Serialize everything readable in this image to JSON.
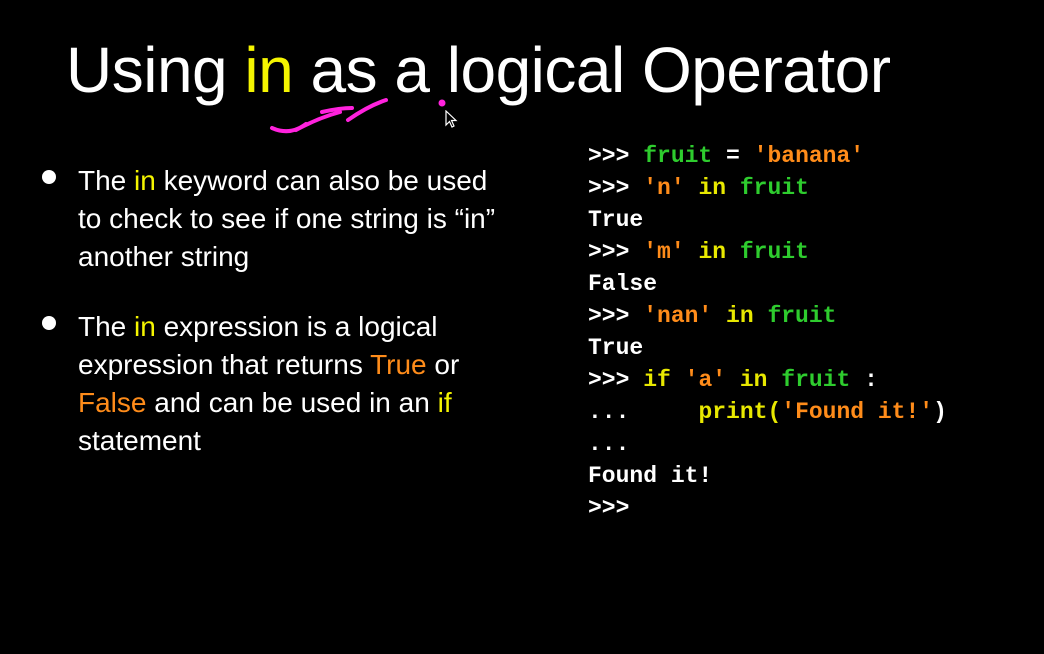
{
  "title": {
    "pre": "Using ",
    "keyword": "in",
    "post": " as a logical Operator"
  },
  "bullets": [
    {
      "t1": "The ",
      "k1": "in",
      "t2": " keyword can also be used to check to see if one string is “in” another string"
    },
    {
      "t1": "The ",
      "k1": "in",
      "t2": " expression is a logical expression that returns ",
      "true_word": "True",
      "t3": " or ",
      "false_word": "False",
      "t4": " and can be used in an ",
      "if_word": "if",
      "t5": " statement"
    }
  ],
  "code": {
    "prompt": ">>> ",
    "cont": "... ",
    "l1": {
      "a": "fruit",
      "b": " = ",
      "c": "'banana'"
    },
    "l2": {
      "a": "'n'",
      "b": " in ",
      "c": "fruit"
    },
    "l3": "True",
    "l4": {
      "a": "'m'",
      "b": " in ",
      "c": "fruit"
    },
    "l5": "False",
    "l6": {
      "a": "'nan'",
      "b": " in ",
      "c": "fruit"
    },
    "l7": "True",
    "l8": {
      "a": "if ",
      "b": "'a'",
      "c": " in ",
      "d": "fruit",
      "e": " :"
    },
    "l9": {
      "indent": "    ",
      "a": "print(",
      "b": "'Found it!'",
      "c": ")"
    },
    "l10": "...",
    "l11": "Found it!",
    "l12": ">>>"
  },
  "colors": {
    "keyword": "#f5f500",
    "string": "#ff8c1a",
    "name": "#2ecc2e",
    "annotation": "#ff22dd"
  }
}
